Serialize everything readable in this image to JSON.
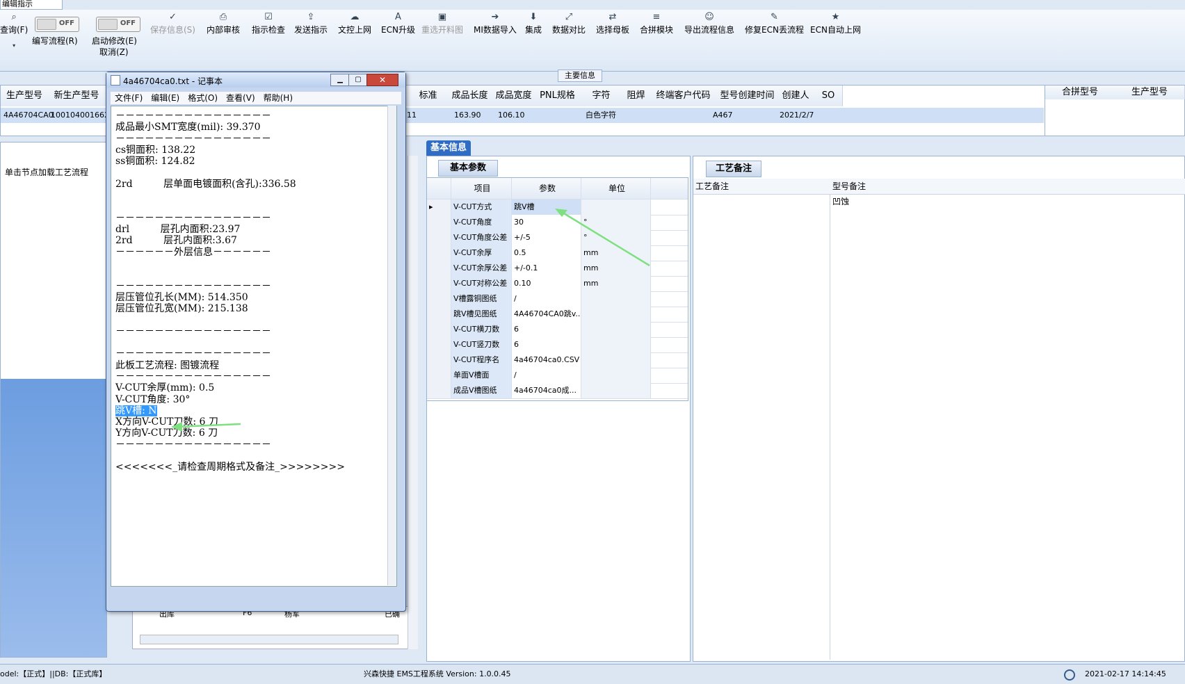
{
  "ribbon_tab": "编辑指示",
  "ribbon": {
    "query_label": "查询(F)",
    "toggle_off": "OFF",
    "edit_flow_label": "编写流程(R)",
    "auto_modify_label": "启动修改(E)",
    "cancel_label": "取消(Z)",
    "buttons": [
      "保存信息(S)",
      "内部审核",
      "指示检查",
      "发送指示",
      "文控上网",
      "ECN升级",
      "重选开料图",
      "MI数据导入",
      "集成",
      "数据对比",
      "选择母板",
      "合拼模块",
      "导出流程信息",
      "修复ECN丢流程",
      "ECN自动上网"
    ]
  },
  "main_info_label": "主要信息",
  "top_grid": {
    "headers": [
      "生产型号",
      "新生产型号",
      "",
      "标准",
      "成品长度",
      "成品宽度",
      "PNL规格",
      "字符",
      "阻焊",
      "终端客户代码",
      "型号创建时间",
      "创建人",
      "SO"
    ],
    "row": [
      "4A46704CA0",
      "100104001662360",
      "11",
      "163.90",
      "106.10",
      "",
      "白色字符",
      "",
      "A467",
      "2021/2/7",
      "",
      ""
    ],
    "right_headers": [
      "合拼型号",
      "生产型号"
    ]
  },
  "left_panel": {
    "hint": "单击节点加载工艺流程",
    "bottom_row": [
      "出库",
      "F6",
      "杨军",
      "已确"
    ]
  },
  "basic_info_tab": "基本信息",
  "basic_params_tab": "基本参数",
  "params_grid": {
    "headers": [
      "项目",
      "参数",
      "单位"
    ],
    "rows": [
      [
        "V-CUT方式",
        "跳V槽",
        ""
      ],
      [
        "V-CUT角度",
        "30",
        "°"
      ],
      [
        "V-CUT角度公差",
        "+/-5",
        "°"
      ],
      [
        "V-CUT余厚",
        "0.5",
        "mm"
      ],
      [
        "V-CUT余厚公差",
        "+/-0.1",
        "mm"
      ],
      [
        "V-CUT对称公差",
        "0.10",
        "mm"
      ],
      [
        "V槽露铜图纸",
        "/",
        ""
      ],
      [
        "跳V槽见图纸",
        "4A46704CA0跳v...",
        ""
      ],
      [
        "V-CUT横刀数",
        "6",
        ""
      ],
      [
        "V-CUT竖刀数",
        "6",
        ""
      ],
      [
        "V-CUT程序名",
        "4a46704ca0.CSV",
        ""
      ],
      [
        "单面V槽面",
        "/",
        ""
      ],
      [
        "成品V槽图纸",
        "4a46704ca0成...",
        ""
      ]
    ]
  },
  "craft_tab": "工艺备注",
  "craft_headers": [
    "工艺备注",
    "型号备注"
  ],
  "model_note": "凹蚀",
  "notepad": {
    "title": "4a46704ca0.txt - 记事本",
    "menu": [
      "文件(F)",
      "编辑(E)",
      "格式(O)",
      "查看(V)",
      "帮助(H)"
    ],
    "lines": [
      "－－－－－－－－－－－－－－－－",
      "成品最小SMT宽度(mil): 39.370",
      "－－－－－－－－－－－－－－－－",
      "cs铜面积: 138.22",
      "ss铜面积: 124.82",
      "",
      "2rd          层单面电镀面积(含孔):336.58",
      "",
      "",
      "－－－－－－－－－－－－－－－－",
      "drl          层孔内面积:23.97",
      "2rd          层孔内面积:3.67",
      "－－－－－－外层信息－－－－－－",
      "",
      "",
      "－－－－－－－－－－－－－－－－",
      "层压管位孔长(MM): 514.350",
      "层压管位孔宽(MM): 215.138",
      "",
      "－－－－－－－－－－－－－－－－",
      "",
      "－－－－－－－－－－－－－－－－",
      "此板工艺流程: 图镀流程",
      "－－－－－－－－－－－－－－－－",
      "V-CUT余厚(mm): 0.5",
      "V-CUT角度: 30°",
      "跳V槽: N",
      "X方向V-CUT刀数: 6 刀",
      "Y方向V-CUT刀数: 6 刀",
      "－－－－－－－－－－－－－－－－",
      "",
      "<<<<<<<_请检查周期格式及备注_>>>>>>>>"
    ]
  },
  "status": {
    "left": "odel:【正式】||DB:【正式库】",
    "center": "兴森快捷 EMS工程系统 Version: 1.0.0.45",
    "right": "2021-02-17 14:14:45"
  },
  "colors": {
    "accent": "#2f6cc4",
    "arrow": "#7ee07e",
    "highlight": "#3399ff"
  }
}
